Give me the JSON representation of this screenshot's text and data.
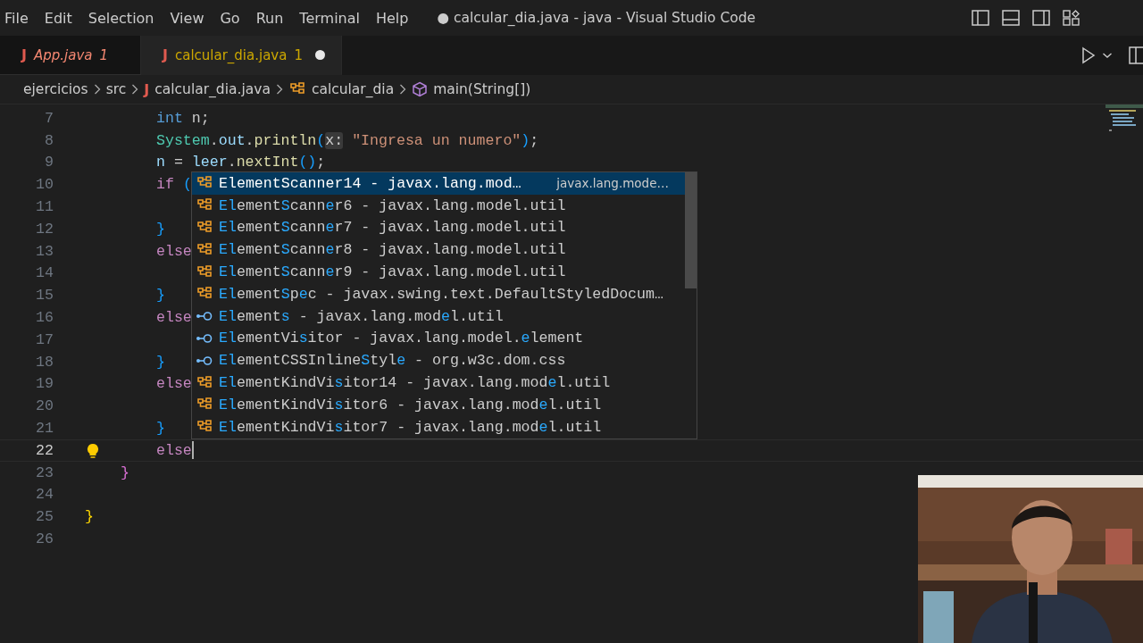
{
  "menu": [
    "File",
    "Edit",
    "Selection",
    "View",
    "Go",
    "Run",
    "Terminal",
    "Help"
  ],
  "window": {
    "title": "● calcular_dia.java - java - Visual Studio Code"
  },
  "tabs": [
    {
      "file_icon": "J",
      "label": "App.java",
      "badge": "1",
      "color": "#f48771",
      "preview": true,
      "dirty": false,
      "selected": false
    },
    {
      "file_icon": "J",
      "label": "calcular_dia.java",
      "badge": "1",
      "color": "#cca700",
      "preview": false,
      "dirty": true,
      "selected": true
    }
  ],
  "breadcrumb": [
    {
      "label": "ejercicios",
      "kind": "folder"
    },
    {
      "label": "src",
      "kind": "folder"
    },
    {
      "label": "calcular_dia.java",
      "kind": "file",
      "file_icon": "J"
    },
    {
      "label": "calcular_dia",
      "kind": "class"
    },
    {
      "label": "main(String[])",
      "kind": "method"
    }
  ],
  "lines": [
    {
      "number": "7",
      "kind": "method-body",
      "current": false,
      "bulb": false,
      "tokens": [
        {
          "text": "int",
          "kind": "kw"
        },
        {
          "text": " n;",
          "kind": "plain"
        }
      ]
    },
    {
      "number": "8",
      "kind": "method-body",
      "current": false,
      "bulb": false,
      "tokens": [
        {
          "text": "System",
          "kind": "type"
        },
        {
          "text": ".",
          "kind": "plain"
        },
        {
          "text": "out",
          "kind": "var"
        },
        {
          "text": ".",
          "kind": "plain"
        },
        {
          "text": "println",
          "kind": "fn"
        },
        {
          "text": "(",
          "kind": "b1"
        },
        {
          "text": "x:",
          "kind": "hint"
        },
        {
          "text": " \"Ingresa un numero\"",
          "kind": "str"
        },
        {
          "text": ")",
          "kind": "b1"
        },
        {
          "text": ";",
          "kind": "plain"
        }
      ]
    },
    {
      "number": "9",
      "kind": "method-body",
      "current": false,
      "bulb": false,
      "tokens": [
        {
          "text": "n",
          "kind": "var"
        },
        {
          "text": " = ",
          "kind": "plain"
        },
        {
          "text": "leer",
          "kind": "var"
        },
        {
          "text": ".",
          "kind": "plain"
        },
        {
          "text": "nextInt",
          "kind": "fn"
        },
        {
          "text": "()",
          "kind": "b1"
        },
        {
          "text": ";",
          "kind": "plain"
        }
      ]
    },
    {
      "number": "10",
      "kind": "method-body",
      "current": false,
      "bulb": false,
      "tokens": [
        {
          "text": "if",
          "kind": "ctrl"
        },
        {
          "text": " (",
          "kind": "b1"
        }
      ]
    },
    {
      "number": "11",
      "kind": "method-body",
      "current": false,
      "bulb": false
    },
    {
      "number": "12",
      "kind": "method-body",
      "current": false,
      "bulb": false,
      "tokens": [
        {
          "text": "}",
          "kind": "b1"
        }
      ]
    },
    {
      "number": "13",
      "kind": "method-body",
      "current": false,
      "bulb": false,
      "tokens": [
        {
          "text": "else",
          "kind": "ctrl"
        }
      ]
    },
    {
      "number": "14",
      "kind": "method-body",
      "current": false,
      "bulb": false
    },
    {
      "number": "15",
      "kind": "method-body",
      "current": false,
      "bulb": false,
      "tokens": [
        {
          "text": "}",
          "kind": "b1"
        }
      ]
    },
    {
      "number": "16",
      "kind": "method-body",
      "current": false,
      "bulb": false,
      "tokens": [
        {
          "text": "else",
          "kind": "ctrl"
        }
      ]
    },
    {
      "number": "17",
      "kind": "method-body",
      "current": false,
      "bulb": false
    },
    {
      "number": "18",
      "kind": "method-body",
      "current": false,
      "bulb": false,
      "tokens": [
        {
          "text": "}",
          "kind": "b1"
        }
      ]
    },
    {
      "number": "19",
      "kind": "method-body",
      "current": false,
      "bulb": false,
      "tokens": [
        {
          "text": "else",
          "kind": "ctrl"
        }
      ]
    },
    {
      "number": "20",
      "kind": "method-body",
      "current": false,
      "bulb": false
    },
    {
      "number": "21",
      "kind": "method-body",
      "current": false,
      "bulb": false,
      "tokens": [
        {
          "text": "}",
          "kind": "b1"
        }
      ]
    },
    {
      "number": "22",
      "kind": "method-body",
      "current": true,
      "bulb": true,
      "tokens": [
        {
          "text": "else",
          "kind": "ctrl"
        }
      ]
    },
    {
      "number": "23",
      "kind": "class-body",
      "current": false,
      "bulb": false,
      "tokens": [
        {
          "text": "}",
          "kind": "b2"
        }
      ]
    },
    {
      "number": "24",
      "kind": "class-body",
      "current": false,
      "bulb": false
    },
    {
      "number": "25",
      "kind": "top-level",
      "current": false,
      "bulb": false,
      "tokens": [
        {
          "text": "}",
          "kind": "b3"
        }
      ]
    },
    {
      "number": "26",
      "kind": "top-level",
      "current": false,
      "bulb": false
    }
  ],
  "suggestions": [
    {
      "kind": "class",
      "selected": true,
      "label": "**El**ement**S**cann**e**r14 - javax.lang.mod…",
      "detail": "javax.lang.mode…"
    },
    {
      "kind": "class",
      "selected": false,
      "label": "**El**ement**S**cann**e**r6 - javax.lang.model.util"
    },
    {
      "kind": "class",
      "selected": false,
      "label": "**El**ement**S**cann**e**r7 - javax.lang.model.util"
    },
    {
      "kind": "class",
      "selected": false,
      "label": "**El**ement**S**cann**e**r8 - javax.lang.model.util"
    },
    {
      "kind": "class",
      "selected": false,
      "label": "**El**ement**S**cann**e**r9 - javax.lang.model.util"
    },
    {
      "kind": "class",
      "selected": false,
      "label": "**El**ement**S**p**e**c - javax.swing.text.DefaultStyledDocum…"
    },
    {
      "kind": "interface",
      "selected": false,
      "label": "**El**ement**s** - javax.lang.mod**e**l.util"
    },
    {
      "kind": "interface",
      "selected": false,
      "label": "**El**ementVi**s**itor - javax.lang.model.**e**lement"
    },
    {
      "kind": "interface",
      "selected": false,
      "label": "**El**ementCSSInline**S**tyl**e** - org.w3c.dom.css"
    },
    {
      "kind": "class",
      "selected": false,
      "label": "**El**ementKindVi**s**itor14 - javax.lang.mod**e**l.util"
    },
    {
      "kind": "class",
      "selected": false,
      "label": "**El**ementKindVi**s**itor6 - javax.lang.mod**e**l.util"
    },
    {
      "kind": "class",
      "selected": false,
      "label": "**El**ementKindVi**s**itor7 - javax.lang.mod**e**l.util"
    }
  ]
}
